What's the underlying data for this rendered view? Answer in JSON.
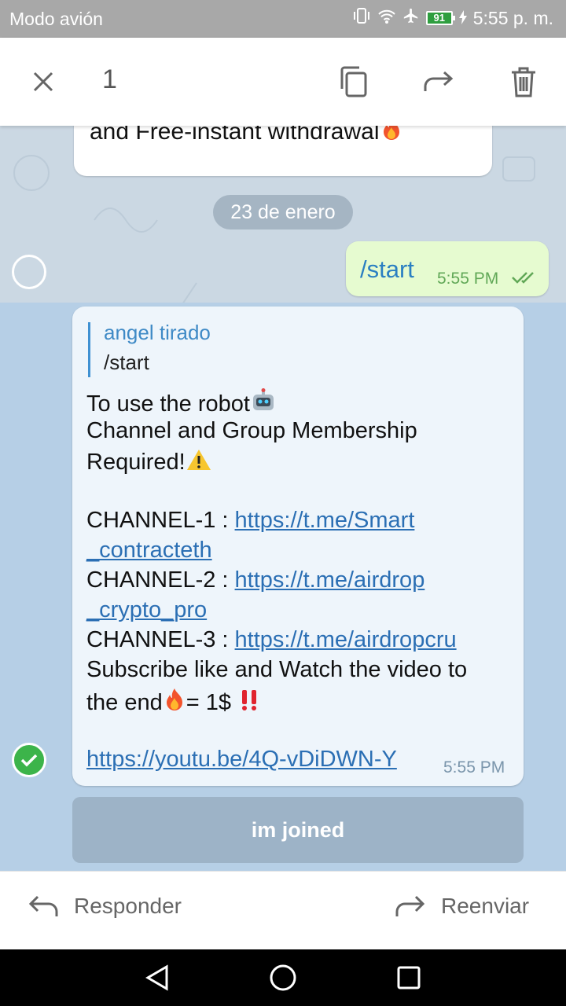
{
  "status_bar": {
    "carrier": "Modo avión",
    "battery": "91",
    "time": "5:55 p. m."
  },
  "action_bar": {
    "selected_count": "1"
  },
  "chat": {
    "previous_message": "and Free-instant withdrawal",
    "date_separator": "23 de enero",
    "outgoing": {
      "text": "/start",
      "time": "5:55 PM"
    },
    "bot_message": {
      "reply_author": "angel tirado",
      "reply_text": "/start",
      "line1": "To use the robot",
      "line2": "Channel and Group Membership",
      "line3": "Required!",
      "channel1_label": "CHANNEL-1 : ",
      "channel1_link_a": "https://t.me/Smart",
      "channel1_link_b": "_contracteth",
      "channel2_label": "CHANNEL-2 : ",
      "channel2_link_a": "https://t.me/airdrop",
      "channel2_link_b": "_crypto_pro",
      "channel3_label": "CHANNEL-3 : ",
      "channel3_link": "https://t.me/airdropcru",
      "line_subscribe": "Subscribe like and Watch the video to",
      "line_end_a": "the end",
      "line_end_b": "= 1$ ",
      "video_link": "https://youtu.be/4Q-vDiDWN-Y",
      "time": "5:55 PM"
    },
    "inline_button": "im joined"
  },
  "bottom_bar": {
    "reply_label": "Responder",
    "forward_label": "Reenviar"
  },
  "colors": {
    "accent": "#3f8ac6",
    "link": "#2b6fb4",
    "selected_check": "#3cb44a",
    "chat_bg": "#cbd8e3"
  }
}
